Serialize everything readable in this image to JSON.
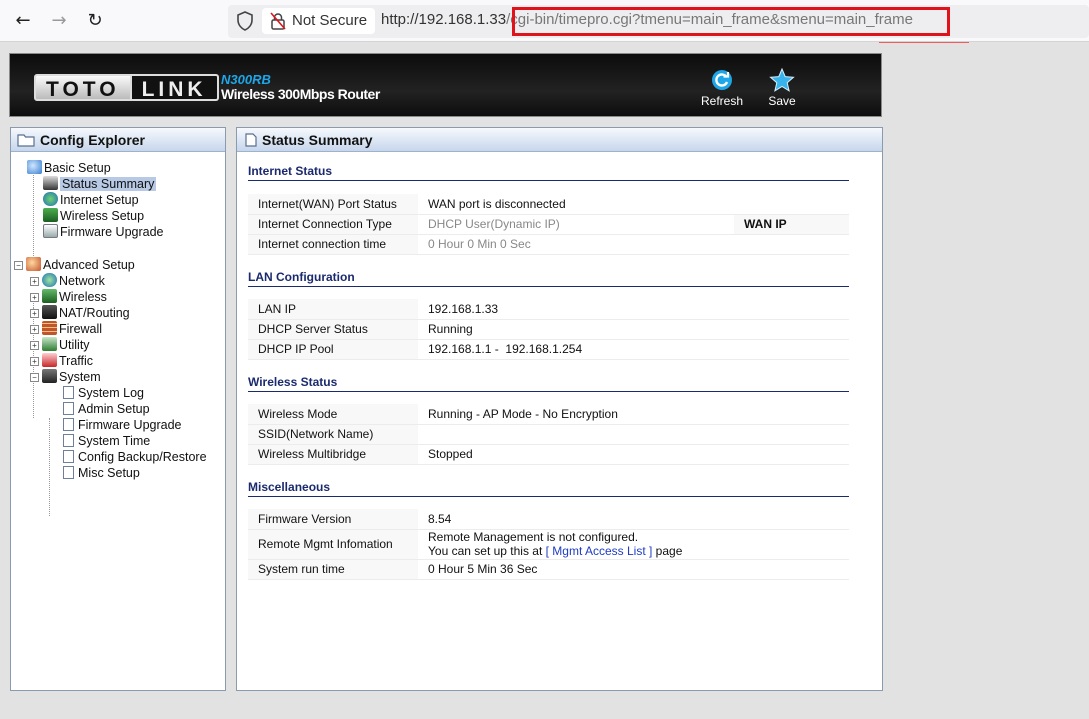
{
  "browser": {
    "security_label": "Not Secure",
    "url_host": "http://192.168.1.33",
    "url_path": "/cgi-bin/timepro.cgi?tmenu=main_frame&smenu=main_frame"
  },
  "header": {
    "logo_left": "TOTO",
    "logo_right": "LINK",
    "model": "N300RB",
    "model_desc": "Wireless 300Mbps Router",
    "refresh_label": "Refresh",
    "save_label": "Save"
  },
  "sidebar": {
    "title": "Config Explorer",
    "basic_setup": "Basic Setup",
    "basic_items": [
      "Status Summary",
      "Internet Setup",
      "Wireless Setup",
      "Firmware Upgrade"
    ],
    "advanced_setup": "Advanced Setup",
    "advanced_items": [
      "Network",
      "Wireless",
      "NAT/Routing",
      "Firewall",
      "Utility",
      "Traffic",
      "System"
    ],
    "system_items": [
      "System Log",
      "Admin Setup",
      "Firmware Upgrade",
      "System Time",
      "Config Backup/Restore",
      "Misc Setup"
    ]
  },
  "main": {
    "title": "Status Summary",
    "internet": {
      "title": "Internet Status",
      "rows": [
        {
          "k": "Internet(WAN) Port Status",
          "v": "WAN port is disconnected"
        },
        {
          "k": "Internet Connection Type",
          "v": "DHCP User(Dynamic IP)",
          "extra": "WAN IP"
        },
        {
          "k": "Internet connection time",
          "v": "0 Hour 0 Min 0 Sec"
        }
      ]
    },
    "lan": {
      "title": "LAN Configuration",
      "rows": [
        {
          "k": "LAN IP",
          "v": "192.168.1.33"
        },
        {
          "k": "DHCP Server Status",
          "v": "Running"
        },
        {
          "k": "DHCP IP Pool",
          "v": "192.168.1.1 -  192.168.1.254"
        }
      ]
    },
    "wireless": {
      "title": "Wireless Status",
      "rows": [
        {
          "k": "Wireless Mode",
          "v": "Running - AP Mode - No Encryption"
        },
        {
          "k": "SSID(Network Name)",
          "v": ""
        },
        {
          "k": "Wireless Multibridge",
          "v": "Stopped"
        }
      ]
    },
    "misc": {
      "title": "Miscellaneous",
      "firmware_k": "Firmware Version",
      "firmware_v": "8.54",
      "remote_k": "Remote Mgmt Infomation",
      "remote_line1": "Remote Management is not configured.",
      "remote_line2_pre": "You can set up this at ",
      "remote_link": "[ Mgmt Access List ]",
      "remote_line2_post": " page",
      "runtime_k": "System run time",
      "runtime_v": "0 Hour 5 Min 36 Sec"
    }
  },
  "colors": {
    "accent_blue": "#1ea7e8",
    "section_title": "#1a2a6e",
    "highlight_red": "#e0131a"
  }
}
